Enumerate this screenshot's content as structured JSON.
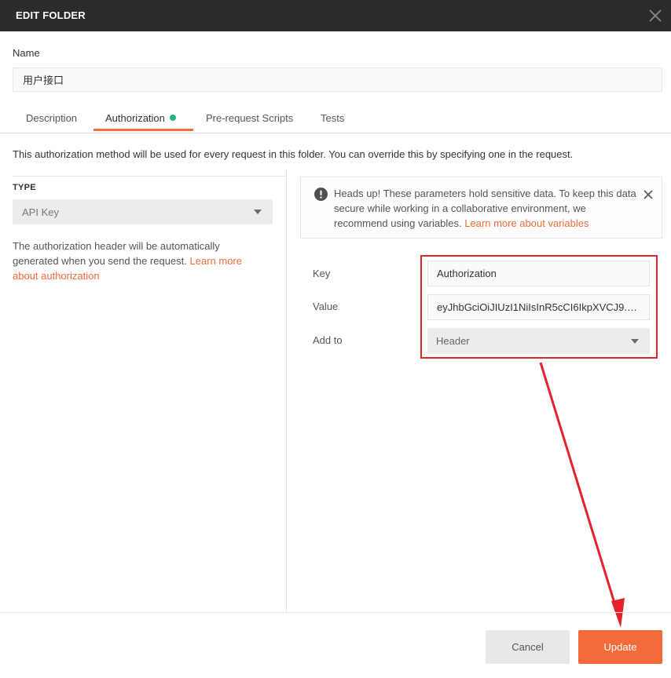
{
  "dialog": {
    "title": "EDIT FOLDER"
  },
  "name_field": {
    "label": "Name",
    "value": "用户接口"
  },
  "tabs": [
    {
      "label": "Description",
      "active": false
    },
    {
      "label": "Authorization",
      "active": true,
      "indicator": "green-dot"
    },
    {
      "label": "Pre-request Scripts",
      "active": false
    },
    {
      "label": "Tests",
      "active": false
    }
  ],
  "info_text": "This authorization method will be used for every request in this folder. You can override this by specifying one in the request.",
  "auth": {
    "type_label": "TYPE",
    "type_value": "API Key",
    "help_text": "The authorization header will be automatically generated when you send the request.",
    "help_link": "Learn more about authorization"
  },
  "alert": {
    "icon": "exclamation-circle-icon",
    "text": "Heads up! These parameters hold sensitive data. To keep this data secure while working in a collaborative environment, we recommend using variables.",
    "link": "Learn more about variables"
  },
  "fields": {
    "key_label": "Key",
    "key_value": "Authorization",
    "value_label": "Value",
    "value_value": "eyJhbGciOiJIUzI1NiIsInR5cCI6IkpXVCJ9.eyJ...",
    "addto_label": "Add to",
    "addto_value": "Header"
  },
  "footer": {
    "cancel_label": "Cancel",
    "update_label": "Update"
  },
  "colors": {
    "accent": "#f26b3a",
    "titlebar": "#2b2b2b",
    "active_dot": "#26b47f",
    "annotation": "#e3222b"
  }
}
